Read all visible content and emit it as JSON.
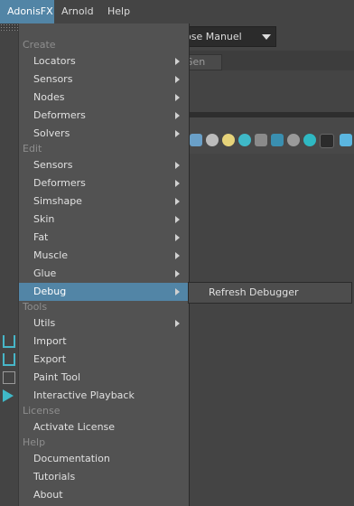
{
  "menubar": {
    "items": [
      {
        "label": "AdonisFX",
        "active": true
      },
      {
        "label": "Arnold",
        "active": false
      },
      {
        "label": "Help",
        "active": false
      }
    ]
  },
  "background": {
    "workspace_value": "ose Manuel",
    "tab_label": "Gen"
  },
  "menu": {
    "sections": [
      {
        "title": "Create",
        "items": [
          {
            "label": "Locators",
            "submenu": true
          },
          {
            "label": "Sensors",
            "submenu": true
          },
          {
            "label": "Nodes",
            "submenu": true
          },
          {
            "label": "Deformers",
            "submenu": true
          },
          {
            "label": "Solvers",
            "submenu": true
          }
        ]
      },
      {
        "title": "Edit",
        "items": [
          {
            "label": "Sensors",
            "submenu": true
          },
          {
            "label": "Deformers",
            "submenu": true
          },
          {
            "label": "Simshape",
            "submenu": true
          },
          {
            "label": "Skin",
            "submenu": true
          },
          {
            "label": "Fat",
            "submenu": true
          },
          {
            "label": "Muscle",
            "submenu": true
          },
          {
            "label": "Glue",
            "submenu": true
          },
          {
            "label": "Debug",
            "submenu": true,
            "highlighted": true
          }
        ]
      },
      {
        "title": "Tools",
        "items": [
          {
            "label": "Utils",
            "submenu": true
          },
          {
            "label": "Import",
            "submenu": false
          },
          {
            "label": "Export",
            "submenu": false
          },
          {
            "label": "Paint Tool",
            "submenu": false
          },
          {
            "label": "Interactive Playback",
            "submenu": false
          }
        ]
      },
      {
        "title": "License",
        "items": [
          {
            "label": "Activate License",
            "submenu": false
          }
        ]
      },
      {
        "title": "Help",
        "items": [
          {
            "label": "Documentation",
            "submenu": false
          },
          {
            "label": "Tutorials",
            "submenu": false
          },
          {
            "label": "About",
            "submenu": false
          }
        ]
      }
    ]
  },
  "submenu": {
    "items": [
      {
        "label": "Refresh Debugger"
      }
    ]
  },
  "colors": {
    "highlight": "#5285a6",
    "menu_bg": "#525252",
    "text": "#e0e0e0",
    "section_text": "#8e8e8e"
  }
}
